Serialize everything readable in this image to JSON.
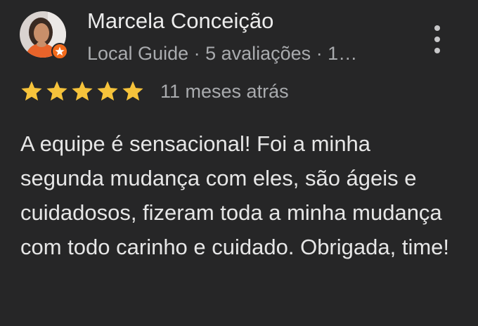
{
  "review": {
    "author": {
      "name": "Marcela Conceição",
      "meta": "Local Guide · 5 avaliações · 1…",
      "avatar_icon": "profile-photo",
      "badge_icon": "local-guide-star-badge",
      "badge_color": "#f26a1b"
    },
    "rating": {
      "stars": 5,
      "max": 5,
      "star_color": "#f6c33b"
    },
    "date": "11 meses atrás",
    "text": "A equipe é sensacional! Foi a minha segunda mudança com eles, são ágeis e cuidadosos, fizeram toda a minha mudança com todo carinho e cuidado. Obrigada, time!",
    "menu_icon": "more-vert-icon"
  }
}
